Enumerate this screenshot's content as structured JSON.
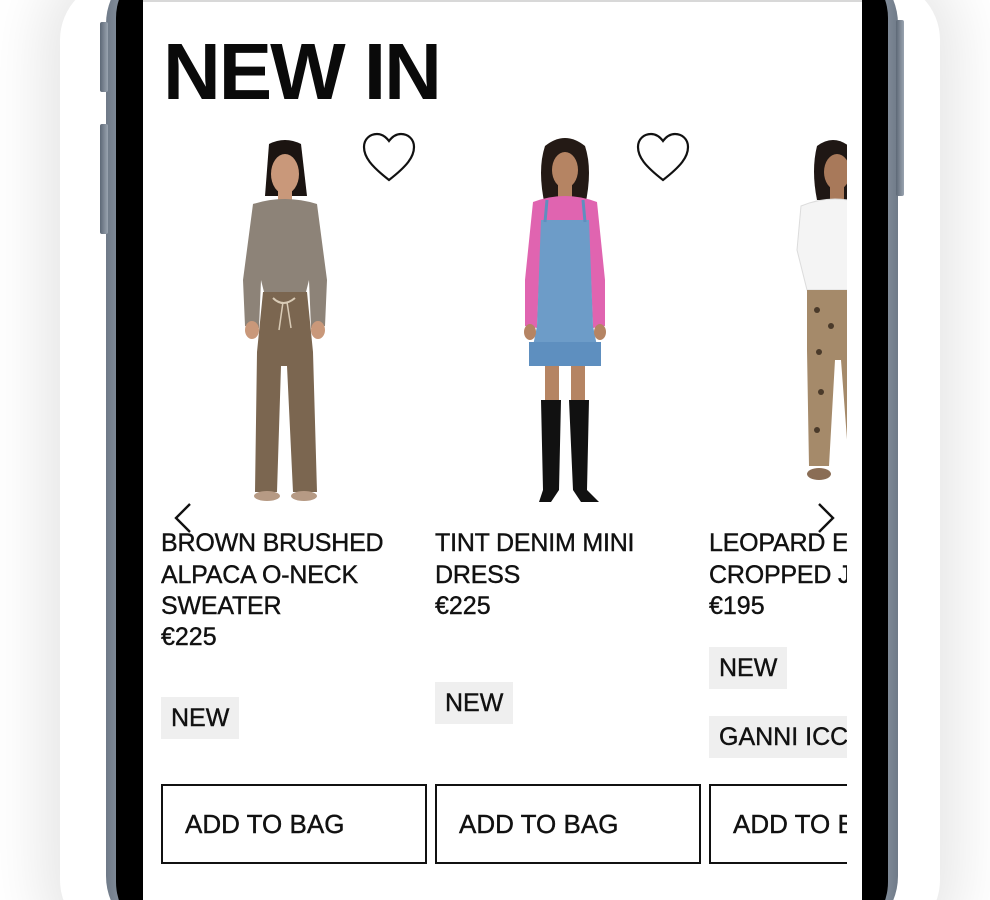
{
  "header": {
    "title": "NEW IN"
  },
  "carousel": {
    "prev_icon": "chevron-left-icon",
    "next_icon": "chevron-right-icon",
    "products": [
      {
        "name": "BROWN BRUSHED\nALPACA O-NECK\nSWEATER",
        "price": "€225",
        "badges": [
          "NEW"
        ],
        "add_to_bag_label": "ADD TO BAG",
        "wishlist_icon": "heart-outline-icon"
      },
      {
        "name": "TINT DENIM MINI\nDRESS",
        "price": "€225",
        "badges": [
          "NEW"
        ],
        "add_to_bag_label": "ADD TO BAG",
        "wishlist_icon": "heart-outline-icon"
      },
      {
        "name": "LEOPARD E\nCROPPED J",
        "price": "€195",
        "badges": [
          "NEW",
          "GANNI ICC"
        ],
        "add_to_bag_label": "ADD TO B",
        "wishlist_icon": "heart-outline-icon"
      }
    ]
  },
  "colors": {
    "text": "#111111",
    "badge_bg": "#efefef",
    "sweater": "#8d8378",
    "pants_brown": "#7b6650",
    "sweater_pink": "#e064b0",
    "denim": "#6d9cc8",
    "blouse_white": "#f4f4f4",
    "leopard": "#a58a6a"
  }
}
